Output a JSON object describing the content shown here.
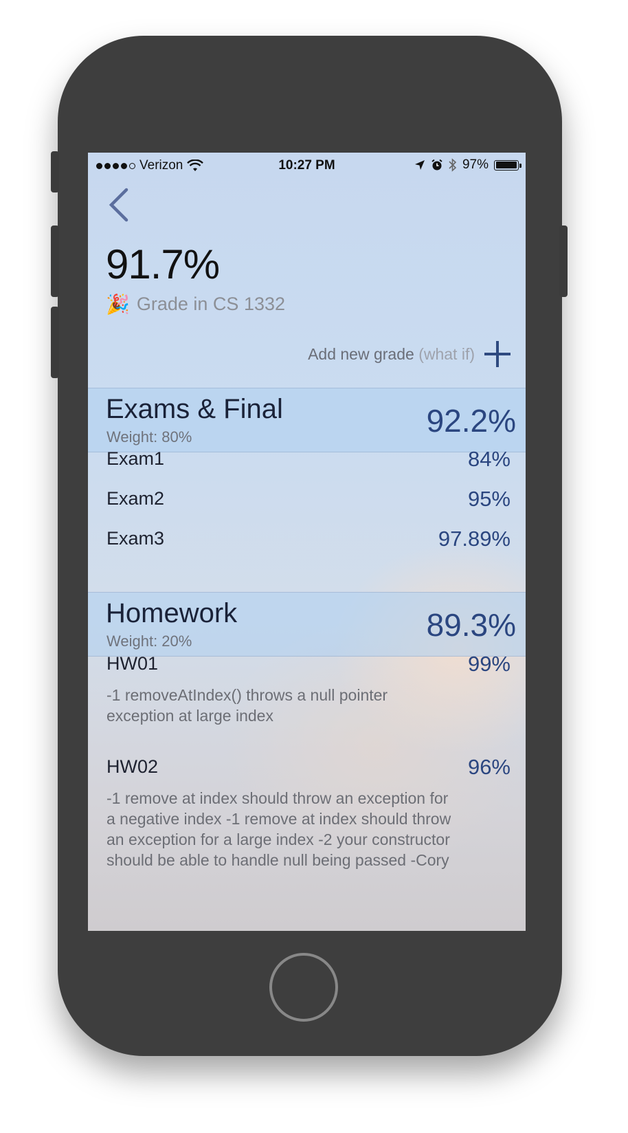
{
  "status_bar": {
    "carrier": "Verizon",
    "signal_bars": 4,
    "time": "10:27 PM",
    "battery": "97%",
    "battery_level": 0.97
  },
  "header": {
    "overall_grade": "91.7%",
    "emoji": "🎉",
    "subtitle": "Grade in CS 1332",
    "add_label": "Add new grade",
    "add_hint": "(what if)"
  },
  "categories": [
    {
      "title": "Exams & Final",
      "weight": "Weight: 80%",
      "average": "92.2%",
      "items": [
        {
          "name": "Exam1",
          "score": "84%"
        },
        {
          "name": "Exam2",
          "score": "95%"
        },
        {
          "name": "Exam3",
          "score": "97.89%"
        }
      ]
    },
    {
      "title": "Homework",
      "weight": "Weight: 20%",
      "average": "89.3%",
      "items": [
        {
          "name": "HW01",
          "score": "99%",
          "note": "-1 removeAtIndex() throws a null pointer exception at large index"
        },
        {
          "name": "HW02",
          "score": "96%",
          "note": "-1 remove at index should throw an exception for a negative index -1 remove at index should throw an exception for a large index -2 your constructor should be able to handle null being passed -Cory"
        }
      ]
    }
  ],
  "colors": {
    "accent": "#2b4680",
    "device": "#3e3e3e"
  }
}
